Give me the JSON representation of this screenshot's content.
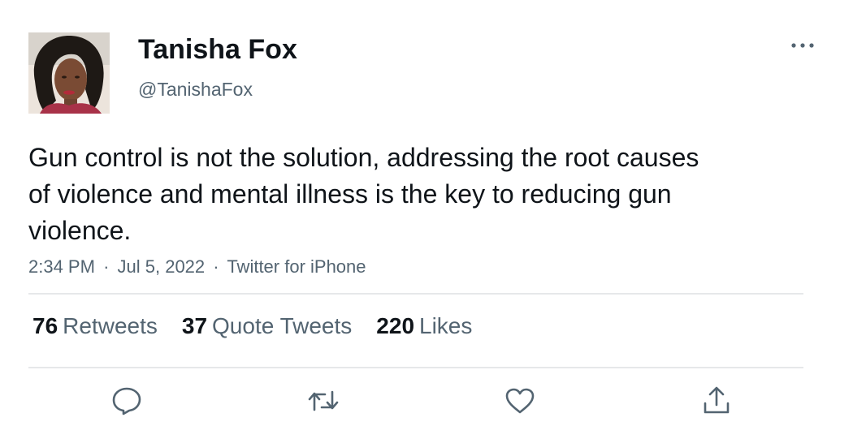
{
  "author": {
    "display_name": "Tanisha Fox",
    "handle": "@TanishaFox"
  },
  "tweet": {
    "text": "Gun control is not the solution, addressing the root causes of violence and mental illness is the key to reducing gun violence.",
    "time": "2:34 PM",
    "separator": "·",
    "date": "Jul 5, 2022",
    "source": "Twitter for iPhone"
  },
  "stats": {
    "retweets": {
      "count": "76",
      "label": "Retweets"
    },
    "quotes": {
      "count": "37",
      "label": "Quote Tweets"
    },
    "likes": {
      "count": "220",
      "label": "Likes"
    }
  },
  "icons": {
    "more": "more-options-icon",
    "reply": "reply-icon",
    "retweet": "retweet-icon",
    "like": "like-icon",
    "share": "share-icon"
  },
  "colors": {
    "text": "#0f1419",
    "secondary": "#536471",
    "divider": "#e6e8ea"
  }
}
